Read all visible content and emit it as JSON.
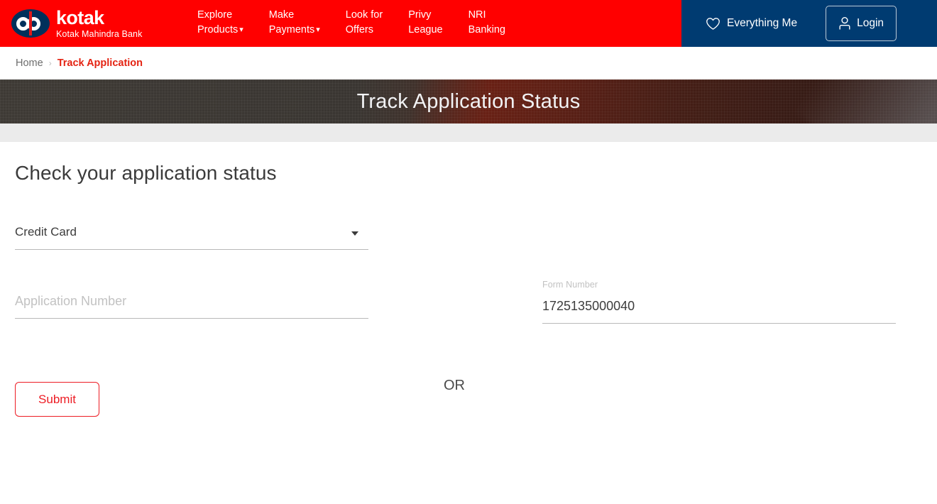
{
  "header": {
    "logo": {
      "name": "kotak",
      "subtitle": "Kotak Mahindra Bank",
      "icon": "kotak-logo-icon"
    },
    "nav_items": [
      {
        "label": "Explore\nProducts",
        "has_caret": true
      },
      {
        "label": "Make\nPayments",
        "has_caret": true
      },
      {
        "label": "Look for\nOffers",
        "has_caret": false
      },
      {
        "label": "Privy\nLeague",
        "has_caret": false
      },
      {
        "label": "NRI\nBanking",
        "has_caret": false
      }
    ],
    "everything_me_label": "Everything Me",
    "login_label": "Login",
    "colors": {
      "red": "#FF0000",
      "navy": "#003B71"
    }
  },
  "breadcrumb": {
    "home_label": "Home",
    "separator": "›",
    "current_label": "Track Application",
    "current_color": "#E42312"
  },
  "banner": {
    "title": "Track Application Status"
  },
  "main": {
    "heading": "Check your application status",
    "product_select": {
      "value": "Credit Card",
      "options": [
        "Credit Card"
      ]
    },
    "application_number": {
      "label": "",
      "placeholder": "Application Number",
      "value": ""
    },
    "or_label": "OR",
    "form_number": {
      "label": "Form Number",
      "placeholder": "Form Number",
      "value": "1725135000040"
    },
    "submit_label": "Submit",
    "submit_color": "#ED1C24"
  }
}
